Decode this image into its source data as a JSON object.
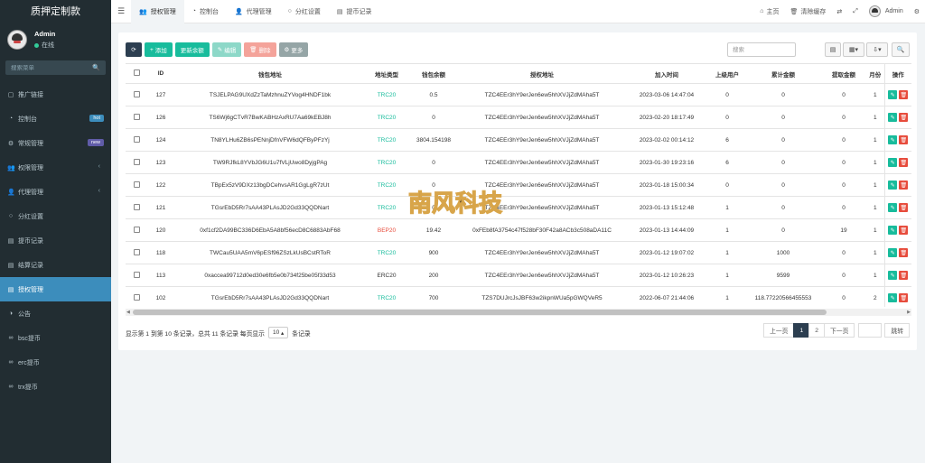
{
  "brand": "质押定制款",
  "user": {
    "name": "Admin",
    "status": "在线"
  },
  "sidebar": {
    "search_placeholder": "搜索菜单",
    "items": [
      {
        "label": "推广链接",
        "icon": "square-icon"
      },
      {
        "label": "控制台",
        "icon": "dashboard-icon",
        "badge": "hot"
      },
      {
        "label": "常规管理",
        "icon": "gear-icon",
        "badge": "new"
      },
      {
        "label": "权限管理",
        "icon": "group-icon",
        "arrow": "‹"
      },
      {
        "label": "代理管理",
        "icon": "user-icon",
        "arrow": "‹"
      },
      {
        "label": "分红设置",
        "icon": "circle-icon"
      },
      {
        "label": "提币记录",
        "icon": "list-icon"
      },
      {
        "label": "结算记录",
        "icon": "list-icon"
      },
      {
        "label": "授权管理",
        "icon": "list-icon",
        "active": true
      },
      {
        "label": "公告",
        "icon": "circle-half-icon"
      },
      {
        "label": "bsc提币",
        "icon": "link-icon"
      },
      {
        "label": "erc提币",
        "icon": "link-icon"
      },
      {
        "label": "trx提币",
        "icon": "link-icon"
      }
    ]
  },
  "topbar": {
    "tabs": [
      {
        "label": "授权管理",
        "active": true
      },
      {
        "label": "控制台"
      },
      {
        "label": "代理管理"
      },
      {
        "label": "分红设置"
      },
      {
        "label": "提币记录"
      }
    ],
    "home": "主页",
    "clear_cache": "清除缓存",
    "admin": "Admin"
  },
  "toolbar": {
    "add": "添加",
    "update_balance": "更新余额",
    "edit": "编辑",
    "delete": "删除",
    "more": "更多",
    "search_placeholder": "搜索"
  },
  "table": {
    "headers": [
      "ID",
      "钱包地址",
      "地址类型",
      "钱包余额",
      "授权地址",
      "加入时间",
      "上级用户",
      "累计金额",
      "提取金额",
      "月份",
      "操作"
    ],
    "rows": [
      [
        "127",
        "TSJELPAG9UXdZzTaMzhnuZYVog4HNDF1bk",
        "TRC20",
        "0.5",
        "TZC4EEr3hY9erJen6ew5hhXVJjZdMAha5T",
        "2023-03-06 14:47:04",
        "0",
        "0",
        "0",
        "1"
      ],
      [
        "126",
        "TS6Wj6gCTvR7BwKABHzAxRU7Aa69kEBJ8h",
        "TRC20",
        "0",
        "TZC4EEr3hY9erJen6ew5hhXVJjZdMAha5T",
        "2023-02-20 18:17:49",
        "0",
        "0",
        "0",
        "1"
      ],
      [
        "124",
        "TN8YLHu6ZB6sPENnjDfnVFW6dQFByPFzYj",
        "TRC20",
        "3804.154198",
        "TZC4EEr3hY9erJen6ew5hhXVJjZdMAha5T",
        "2023-02-02 00:14:12",
        "6",
        "0",
        "0",
        "1"
      ],
      [
        "123",
        "TW9RJfkL8YVbJG6U1u7fVLjUwo8DyjgPAg",
        "TRC20",
        "0",
        "TZC4EEr3hY9erJen6ew5hhXVJjZdMAha5T",
        "2023-01-30 19:23:16",
        "6",
        "0",
        "0",
        "1"
      ],
      [
        "122",
        "TBpEx5zV9DXz13bgDCehvsAR1GgLgR7zUt",
        "TRC20",
        "0",
        "TZC4EEr3hY9erJen6ew5hhXVJjZdMAha5T",
        "2023-01-18 15:00:34",
        "0",
        "0",
        "0",
        "1"
      ],
      [
        "121",
        "TGsrEbD5Rr7sAA43PLAsJD2Gd33QQDNart",
        "TRC20",
        "0",
        "TZC4EEr3hY9erJen6ew5hhXVJjZdMAha5T",
        "2023-01-13 15:12:48",
        "1",
        "0",
        "0",
        "1"
      ],
      [
        "120",
        "0xf1cf2DA99BC336D6EbA5A8bf56ecD8C6883AbF68",
        "BEP20",
        "19.42",
        "0xFEb8fA3754c47f528bF30F42a8ACb3c508aDA11C",
        "2023-01-13 14:44:09",
        "1",
        "0",
        "19",
        "1"
      ],
      [
        "118",
        "TWCau5UAA5mV6pESf96ZSzLkUsBCstRToR",
        "TRC20",
        "900",
        "TZC4EEr3hY9erJen6ew5hhXVJjZdMAha5T",
        "2023-01-12 19:07:02",
        "1",
        "1000",
        "0",
        "1"
      ],
      [
        "113",
        "0xaccea99712d0ed30e6fb5e0b734f25be05f33d53",
        "ERC20",
        "200",
        "TZC4EEr3hY9erJen6ew5hhXVJjZdMAha5T",
        "2023-01-12 10:26:23",
        "1",
        "9599",
        "0",
        "1"
      ],
      [
        "102",
        "TGsrEbD5Rr7sAA43PLAsJD2Gd33QQDNart",
        "TRC20",
        "700",
        "TZS7DUJrcJsJBF63w2ikpnWUa5pGWQVeR5",
        "2022-06-07 21:44:06",
        "1",
        "118.77220566455553",
        "0",
        "2"
      ]
    ]
  },
  "footer": {
    "info_prefix": "显示第 1 到第 10 条记录，总共 11 条记录 每页显示",
    "page_size": "10",
    "info_suffix": "条记录"
  },
  "pagination": {
    "prev": "上一页",
    "pages": [
      "1",
      "2"
    ],
    "next": "下一页",
    "jump": "跳转"
  },
  "watermark": {
    "text": "南风科技"
  }
}
